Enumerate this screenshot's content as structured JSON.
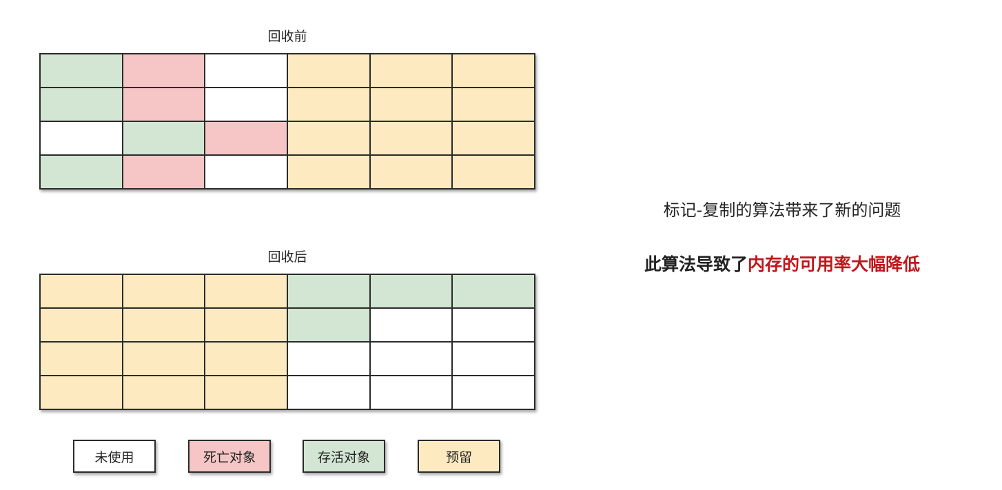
{
  "colors": {
    "unused": "#ffffff",
    "dead": "#f6c6c6",
    "alive": "#d3e5d3",
    "reserved": "#fdeac0",
    "highlight": "#c0171c"
  },
  "before": {
    "title": "回收前",
    "rows": [
      [
        "alive",
        "dead",
        "unused",
        "reserved",
        "reserved",
        "reserved"
      ],
      [
        "alive",
        "dead",
        "unused",
        "reserved",
        "reserved",
        "reserved"
      ],
      [
        "unused",
        "alive",
        "dead",
        "reserved",
        "reserved",
        "reserved"
      ],
      [
        "alive",
        "dead",
        "unused",
        "reserved",
        "reserved",
        "reserved"
      ]
    ]
  },
  "after": {
    "title": "回收后",
    "rows": [
      [
        "reserved",
        "reserved",
        "reserved",
        "alive",
        "alive",
        "alive"
      ],
      [
        "reserved",
        "reserved",
        "reserved",
        "alive",
        "unused",
        "unused"
      ],
      [
        "reserved",
        "reserved",
        "reserved",
        "unused",
        "unused",
        "unused"
      ],
      [
        "reserved",
        "reserved",
        "reserved",
        "unused",
        "unused",
        "unused"
      ]
    ]
  },
  "legend": [
    {
      "key": "unused",
      "label": "未使用"
    },
    {
      "key": "dead",
      "label": "死亡对象"
    },
    {
      "key": "alive",
      "label": "存活对象"
    },
    {
      "key": "reserved",
      "label": "预留"
    }
  ],
  "notes": {
    "line1": "标记-复制的算法带来了新的问题",
    "line2_prefix": "此算法导致了",
    "line2_highlight": "内存的可用率大幅降低"
  }
}
